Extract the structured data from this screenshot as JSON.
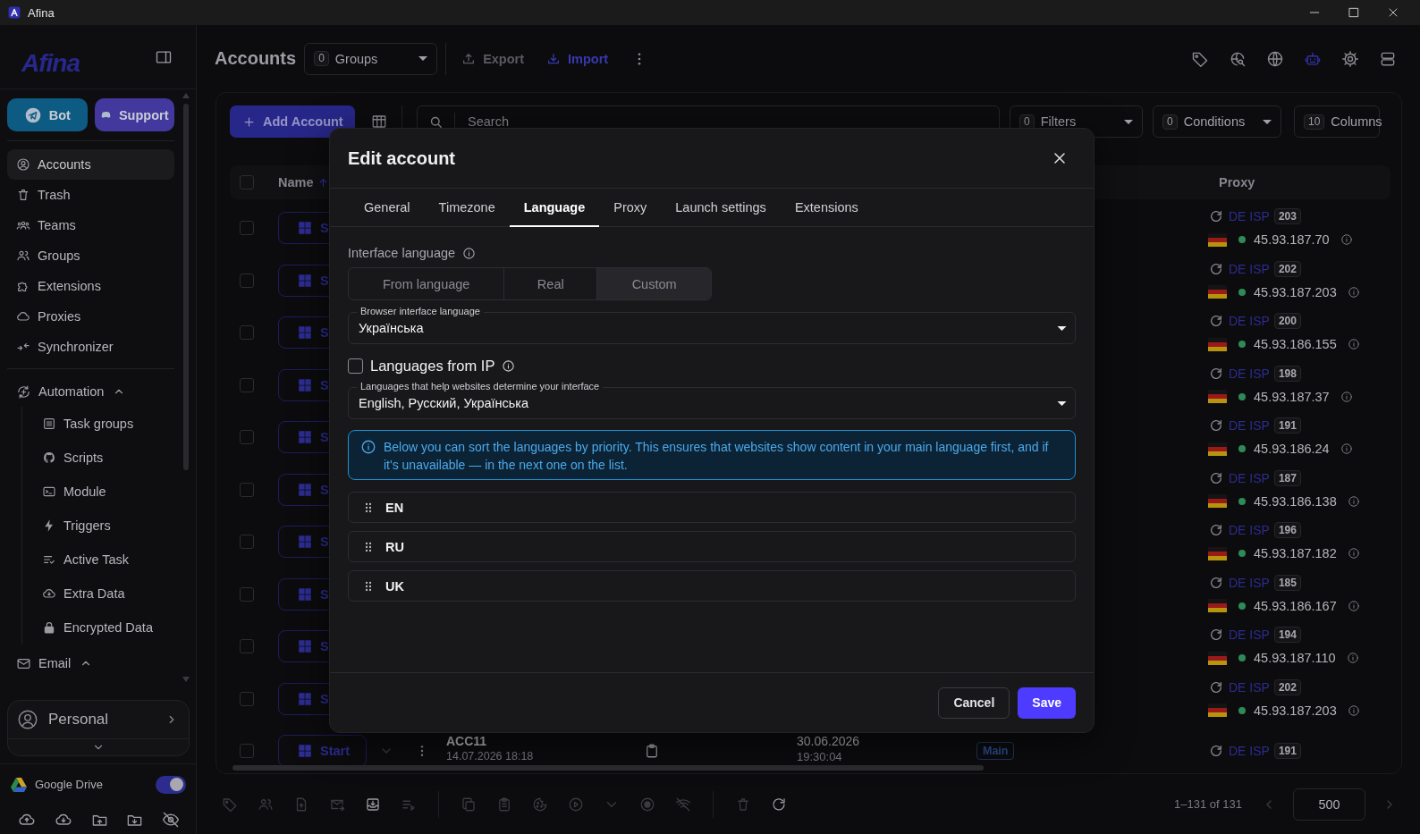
{
  "window": {
    "title": "Afina"
  },
  "sidebar": {
    "logo": "Afina",
    "buttons": [
      {
        "label": "Bot",
        "kind": "telegram"
      },
      {
        "label": "Support",
        "kind": "discord"
      }
    ],
    "nav": [
      {
        "label": "Accounts",
        "selected": true
      },
      {
        "label": "Trash",
        "selected": false
      },
      {
        "label": "Teams",
        "selected": false
      },
      {
        "label": "Groups",
        "selected": false
      },
      {
        "label": "Extensions",
        "selected": false
      },
      {
        "label": "Proxies",
        "selected": false
      },
      {
        "label": "Synchronizer",
        "selected": false
      }
    ],
    "sections": [
      {
        "label": "Automation",
        "expanded": true,
        "children": [
          {
            "label": "Task groups",
            "selected": false
          },
          {
            "label": "Scripts",
            "selected": false
          },
          {
            "label": "Module",
            "selected": false
          },
          {
            "label": "Triggers",
            "selected": false
          },
          {
            "label": "Active Task",
            "selected": false
          },
          {
            "label": "Extra Data",
            "selected": false
          },
          {
            "label": "Encrypted Data",
            "selected": false
          }
        ]
      },
      {
        "label": "Email",
        "expanded": true
      }
    ],
    "workspace": {
      "label": "Personal"
    },
    "google_drive": {
      "label": "Google Drive",
      "on": true
    }
  },
  "header": {
    "title": "Accounts",
    "groups": {
      "count": "0",
      "label": "Groups"
    },
    "actions": [
      {
        "label": "Export",
        "disabled": true,
        "kind": "export"
      },
      {
        "label": "Import",
        "disabled": false,
        "kind": "import"
      }
    ]
  },
  "toolbar": {
    "add_button": "Add Account",
    "search": {
      "placeholder": "Search"
    },
    "selects": [
      {
        "count": "0",
        "label": "Filters",
        "kind": "dropdown"
      },
      {
        "count": "0",
        "label": "Conditions",
        "kind": "dropdown"
      },
      {
        "count": "10",
        "label": "Columns",
        "kind": "button"
      }
    ]
  },
  "table": {
    "all_checked": false,
    "columns": [
      {
        "label": "Name",
        "sorted": true
      },
      {
        "label": "Proxy",
        "sorted": false
      }
    ],
    "rows": [
      {
        "checked": false,
        "start": "S",
        "proxy": {
          "type": "DE ISP",
          "number": "203",
          "ip": "45.93.187.70",
          "online": true
        }
      },
      {
        "checked": false,
        "start": "S",
        "proxy": {
          "type": "DE ISP",
          "number": "202",
          "ip": "45.93.187.203",
          "online": true
        }
      },
      {
        "checked": false,
        "start": "S",
        "proxy": {
          "type": "DE ISP",
          "number": "200",
          "ip": "45.93.186.155",
          "online": true
        }
      },
      {
        "checked": false,
        "start": "S",
        "proxy": {
          "type": "DE ISP",
          "number": "198",
          "ip": "45.93.187.37",
          "online": true
        }
      },
      {
        "checked": false,
        "start": "S",
        "proxy": {
          "type": "DE ISP",
          "number": "191",
          "ip": "45.93.186.24",
          "online": true
        }
      },
      {
        "checked": false,
        "start": "S",
        "proxy": {
          "type": "DE ISP",
          "number": "187",
          "ip": "45.93.186.138",
          "online": true
        }
      },
      {
        "checked": false,
        "start": "S",
        "proxy": {
          "type": "DE ISP",
          "number": "196",
          "ip": "45.93.187.182",
          "online": true
        }
      },
      {
        "checked": false,
        "start": "S",
        "proxy": {
          "type": "DE ISP",
          "number": "185",
          "ip": "45.93.186.167",
          "online": true
        }
      },
      {
        "checked": false,
        "start": "S",
        "proxy": {
          "type": "DE ISP",
          "number": "194",
          "ip": "45.93.187.110",
          "online": true
        }
      },
      {
        "checked": false,
        "start": "S",
        "proxy": {
          "type": "DE ISP",
          "number": "202",
          "ip": "45.93.187.203",
          "online": true
        }
      },
      {
        "checked": false,
        "start": "Start",
        "name": "ACC11",
        "created": "14.07.2026 18:18",
        "date": "30.06.2026",
        "time": "19:30:04",
        "tag": "Main",
        "proxy": {
          "type": "DE ISP",
          "number": "191"
        }
      }
    ]
  },
  "pagination": {
    "range": "1–131 of 131",
    "page_size": "500"
  },
  "dialog": {
    "title": "Edit account",
    "tabs": [
      {
        "label": "General",
        "selected": false
      },
      {
        "label": "Timezone",
        "selected": false
      },
      {
        "label": "Language",
        "selected": true
      },
      {
        "label": "Proxy",
        "selected": false
      },
      {
        "label": "Launch settings",
        "selected": false
      },
      {
        "label": "Extensions",
        "selected": false
      }
    ],
    "interface_language": {
      "label": "Interface language",
      "options": [
        {
          "label": "From language",
          "selected": false
        },
        {
          "label": "Real",
          "selected": false
        },
        {
          "label": "Custom",
          "selected": true
        }
      ]
    },
    "browser_language": {
      "label": "Browser interface language",
      "value": "Українська"
    },
    "languages_from_ip": {
      "label": "Languages from IP",
      "checked": false
    },
    "languages": {
      "label": "Languages that help websites determine your interface",
      "value": "English, Русский, Українська"
    },
    "info": "Below you can sort the languages by priority. This ensures that websites show content in your main language first, and if it's unavailable — in the next one on the list.",
    "priority": [
      "EN",
      "RU",
      "UK"
    ],
    "buttons": [
      {
        "label": "Cancel",
        "kind": "secondary"
      },
      {
        "label": "Save",
        "kind": "primary"
      }
    ]
  }
}
